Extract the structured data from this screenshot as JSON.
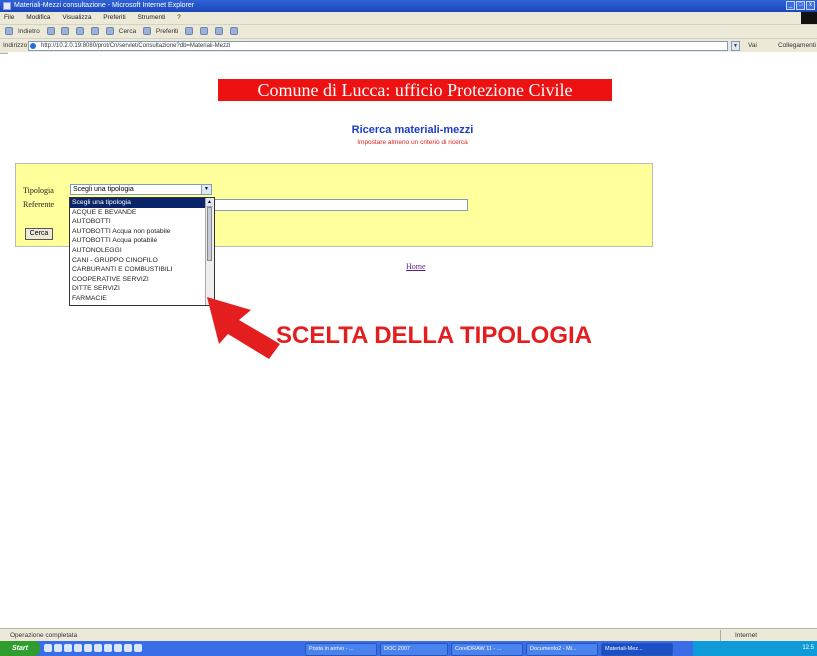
{
  "window": {
    "title": "Materiali-Mezzi consultazione - Microsoft Internet Explorer",
    "min_label": "_",
    "max_label": "□",
    "close_label": "x"
  },
  "menu": [
    "File",
    "Modifica",
    "Visualizza",
    "Preferiti",
    "Strumenti",
    "?"
  ],
  "toolbar": {
    "back_label": "Indietro",
    "search_label": "Cerca",
    "favorites_label": "Preferiti"
  },
  "address": {
    "label": "Indirizzo",
    "url": "http://10.2.0.19:8080/prot/Cn/servlet/Consultazione?db=Materiali-Mezzi",
    "go_label": "Vai",
    "links_label": "Collegamenti"
  },
  "page": {
    "banner": "Comune di Lucca: ufficio Protezione Civile",
    "heading": "Ricerca materiali-mezzi",
    "subheading": "Impostare almeno un criterio di ricerca",
    "tipologia_label": "Tipologia",
    "referente_label": "Referente",
    "select_value": "Scegli una tipologia",
    "search_button": "Cerca",
    "home_link": "Home",
    "dropdown_options": [
      "Scegli una tipologia",
      "ACQUE E BEVANDE",
      "AUTOBOTTI",
      "AUTOBOTTI Acqua non potabile",
      "AUTOBOTTI Acqua potabile",
      "AUTONOLEGGI",
      "CANI - GRUPPO CINOFILO",
      "CARBURANTI E COMBUSTIBILI",
      "COOPERATIVE SERVIZI",
      "DITTE SERVIZI",
      "FARMACIE"
    ]
  },
  "callout": "SCELTA DELLA TIPOLOGIA",
  "status": {
    "text": "Operazione completata",
    "zone": "Internet"
  },
  "taskbar": {
    "start": "Start",
    "tasks": [
      "Posta in arrivo - ...",
      "DOC 2007",
      "CorelDRAW 11 - ...",
      "Documento2 - Mi...",
      "Materiali-Mez..."
    ],
    "clock": "12.5"
  },
  "colors": {
    "banner_bg": "#ee1111",
    "panel_bg": "#ffff9c",
    "heading": "#1a3cc8",
    "callout": "#e41e1e"
  }
}
